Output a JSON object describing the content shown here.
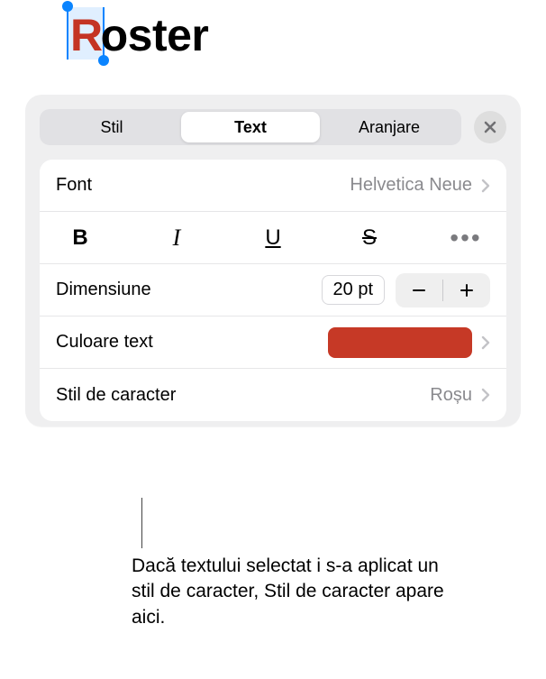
{
  "canvas": {
    "first_letter": "R",
    "rest": "oster"
  },
  "tabs": {
    "style": "Stil",
    "text": "Text",
    "arrange": "Aranjare"
  },
  "font": {
    "label": "Font",
    "value": "Helvetica Neue"
  },
  "format_glyphs": {
    "bold": "B",
    "italic": "I",
    "underline": "U",
    "strike": "S",
    "more": "•••"
  },
  "size": {
    "label": "Dimensiune",
    "value": "20 pt"
  },
  "text_color": {
    "label": "Culoare text",
    "swatch_hex": "#c63926"
  },
  "char_style": {
    "label": "Stil de caracter",
    "value": "Roșu"
  },
  "callout": "Dacă textului selectat i s-a aplicat un stil de caracter, Stil de caracter apare aici."
}
